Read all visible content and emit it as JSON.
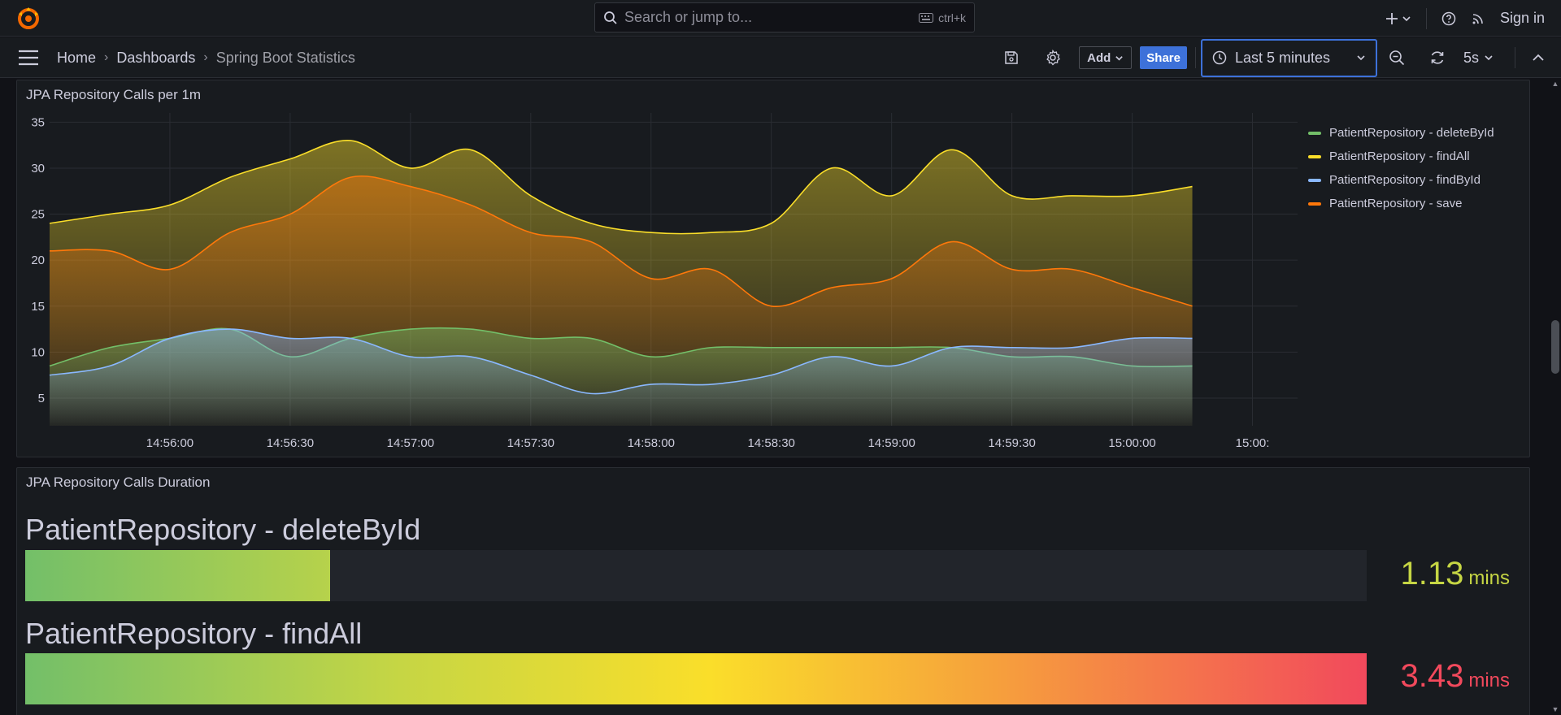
{
  "topbar": {
    "search_placeholder": "Search or jump to...",
    "search_shortcut": "ctrl+k",
    "sign_in": "Sign in",
    "icons": [
      "grafana-logo",
      "plus-icon",
      "help-icon",
      "rss-icon"
    ]
  },
  "nav": {
    "breadcrumbs": [
      "Home",
      "Dashboards",
      "Spring Boot Statistics"
    ],
    "add_label": "Add",
    "share_label": "Share",
    "time_range": "Last 5 minutes",
    "refresh_interval": "5s"
  },
  "panel_calls": {
    "title": "JPA Repository Calls per 1m"
  },
  "panel_duration": {
    "title": "JPA Repository Calls Duration",
    "bars": [
      {
        "label": "PatientRepository - deleteById",
        "value": "1.13",
        "unit": "mins",
        "fraction": 0.227,
        "color": "#c6d644"
      },
      {
        "label": "PatientRepository - findAll",
        "value": "3.43",
        "unit": "mins",
        "fraction": 1.0,
        "color": "#f2495c"
      }
    ]
  },
  "chart_data": {
    "type": "area",
    "title": "JPA Repository Calls per 1m",
    "x": [
      "14:55:30",
      "14:55:45",
      "14:56:00",
      "14:56:15",
      "14:56:30",
      "14:56:45",
      "14:57:00",
      "14:57:15",
      "14:57:30",
      "14:57:45",
      "14:58:00",
      "14:58:15",
      "14:58:30",
      "14:58:45",
      "14:59:00",
      "14:59:15",
      "14:59:30",
      "14:59:45",
      "15:00:00",
      "15:00:15"
    ],
    "x_ticks": [
      "14:56:00",
      "14:56:30",
      "14:57:00",
      "14:57:30",
      "14:58:00",
      "14:58:30",
      "14:59:00",
      "14:59:30",
      "15:00:00",
      "15:00:"
    ],
    "y_ticks": [
      5,
      10,
      15,
      20,
      25,
      30,
      35
    ],
    "ylim": [
      2,
      36
    ],
    "grid": true,
    "legend_position": "right",
    "series": [
      {
        "name": "PatientRepository - deleteById",
        "color": "#73bf69",
        "values": [
          8.5,
          10.5,
          11.5,
          12.5,
          9.5,
          11.5,
          12.5,
          12.5,
          11.5,
          11.5,
          9.5,
          10.5,
          10.5,
          10.5,
          10.5,
          10.5,
          9.5,
          9.5,
          8.5,
          8.5
        ]
      },
      {
        "name": "PatientRepository - findAll",
        "color": "#fade2a",
        "values": [
          24,
          25,
          26,
          29,
          31,
          33,
          30,
          32,
          27,
          24,
          23,
          23,
          24,
          30,
          27,
          32,
          27,
          27,
          27,
          28
        ]
      },
      {
        "name": "PatientRepository - findById",
        "color": "#8ab8ff",
        "values": [
          7.5,
          8.5,
          11.5,
          12.5,
          11.5,
          11.5,
          9.5,
          9.5,
          7.5,
          5.5,
          6.5,
          6.5,
          7.5,
          9.5,
          8.5,
          10.5,
          10.5,
          10.5,
          11.5,
          11.5
        ]
      },
      {
        "name": "PatientRepository - save",
        "color": "#ff780a",
        "values": [
          21,
          21,
          19,
          23,
          25,
          29,
          28,
          26,
          23,
          22,
          18,
          19,
          15,
          17,
          18,
          22,
          19,
          19,
          17,
          15
        ]
      }
    ]
  }
}
